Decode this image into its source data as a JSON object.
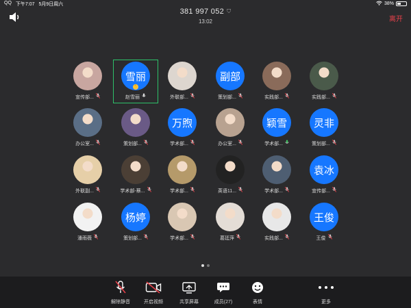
{
  "status": {
    "app": "QQ",
    "time": "下午7:07",
    "date": "5月9日周六",
    "battery": "38%"
  },
  "header": {
    "meeting_id": "381 997 052",
    "duration": "13:02",
    "leave_label": "离开"
  },
  "participants": [
    {
      "name": "宣传部...",
      "avatar": "",
      "mic": "muted",
      "style": "photo",
      "color": "#c8a6a0"
    },
    {
      "name": "赵雪丽",
      "avatar": "雪丽",
      "mic": "on",
      "style": "text",
      "selected": true,
      "hand": true
    },
    {
      "name": "外联部...",
      "avatar": "",
      "mic": "muted",
      "style": "photo",
      "color": "#ddd6cf"
    },
    {
      "name": "策划部...",
      "avatar": "副部",
      "mic": "muted",
      "style": "text"
    },
    {
      "name": "实践部...",
      "avatar": "",
      "mic": "muted",
      "style": "photo",
      "color": "#8a6b5a"
    },
    {
      "name": "实践部...",
      "avatar": "",
      "mic": "muted",
      "style": "photo",
      "color": "#4a5a4a"
    },
    {
      "name": "办公室...",
      "avatar": "",
      "mic": "muted",
      "style": "photo",
      "color": "#5a6e86"
    },
    {
      "name": "策划部...",
      "avatar": "",
      "mic": "muted",
      "style": "photo",
      "color": "#6a5a86"
    },
    {
      "name": "学术部...",
      "avatar": "万煦",
      "mic": "muted",
      "style": "text"
    },
    {
      "name": "办公室...",
      "avatar": "",
      "mic": "muted",
      "style": "photo",
      "color": "#b8a290"
    },
    {
      "name": "学术部...",
      "avatar": "颖雪",
      "mic": "active",
      "style": "text"
    },
    {
      "name": "策划部...",
      "avatar": "灵非",
      "mic": "muted",
      "style": "text"
    },
    {
      "name": "外联副...",
      "avatar": "",
      "mic": "muted",
      "style": "photo",
      "color": "#e6cfa8"
    },
    {
      "name": "学术部-蔡...",
      "avatar": "",
      "mic": "muted",
      "style": "photo",
      "color": "#4b3f35"
    },
    {
      "name": "学术部...",
      "avatar": "",
      "mic": "muted",
      "style": "photo",
      "color": "#b59a6a"
    },
    {
      "name": "英语11...",
      "avatar": "",
      "mic": "muted",
      "style": "photo",
      "color": "#222"
    },
    {
      "name": "学术部...",
      "avatar": "",
      "mic": "muted",
      "style": "photo",
      "color": "#4e5e72"
    },
    {
      "name": "宣传部...",
      "avatar": "袁冰",
      "mic": "muted",
      "style": "text"
    },
    {
      "name": "潘雨薇",
      "avatar": "",
      "mic": "muted",
      "style": "photo",
      "color": "#f2f2f2"
    },
    {
      "name": "策划部...",
      "avatar": "杨婷",
      "mic": "muted",
      "style": "text"
    },
    {
      "name": "学术部...",
      "avatar": "",
      "mic": "muted",
      "style": "photo",
      "color": "#d9c7b3"
    },
    {
      "name": "葛廷萍",
      "avatar": "",
      "mic": "muted",
      "style": "photo",
      "color": "#e4ddd6"
    },
    {
      "name": "实践部...",
      "avatar": "",
      "mic": "muted",
      "style": "photo",
      "color": "#e8e8e8"
    },
    {
      "name": "王俊",
      "avatar": "王俊",
      "mic": "muted",
      "style": "text"
    }
  ],
  "pager": {
    "pages": 2,
    "active": 0
  },
  "toolbar": {
    "unmute": "解除静音",
    "video": "开启视频",
    "share": "共享屏幕",
    "members": "成员(27)",
    "emoji": "表情",
    "more": "更多"
  }
}
